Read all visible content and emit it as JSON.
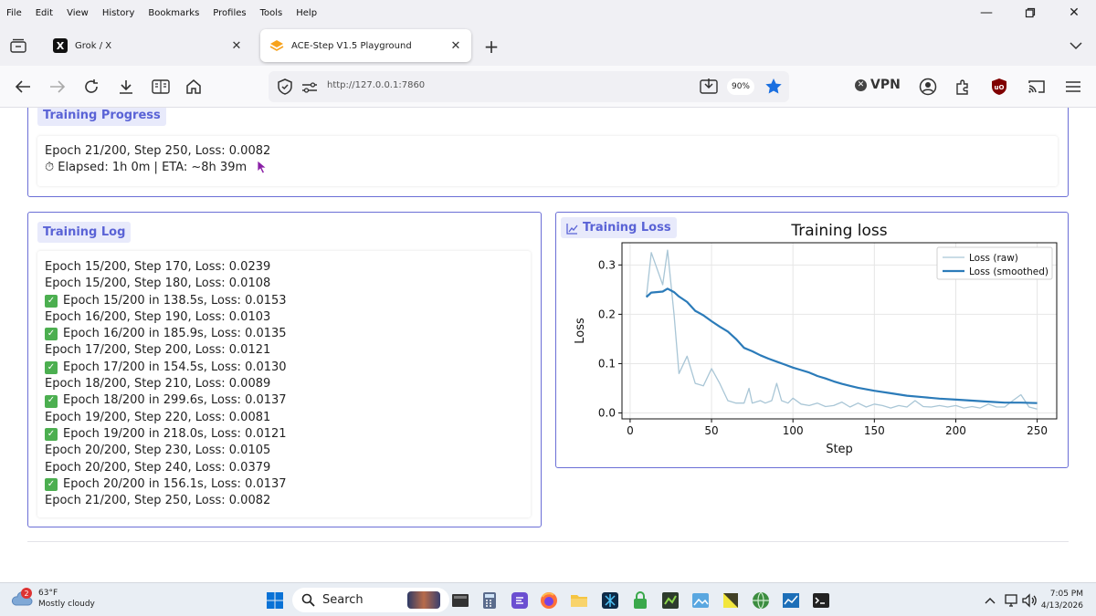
{
  "menu": {
    "items": [
      "File",
      "Edit",
      "View",
      "History",
      "Bookmarks",
      "Profiles",
      "Tools",
      "Help"
    ]
  },
  "tabs": [
    {
      "title": "Grok / X",
      "active": false
    },
    {
      "title": "ACE-Step V1.5 Playground",
      "active": true
    }
  ],
  "navbar": {
    "url": "http://127.0.0.1:7860",
    "zoom": "90%",
    "vpn_label": "VPN"
  },
  "progress_panel": {
    "badge": "Training Progress",
    "line1": "Epoch 21/200, Step 250, Loss: 0.0082",
    "line2": "⏱ Elapsed: 1h 0m | ETA: ~8h 39m"
  },
  "log_panel": {
    "badge": "Training Log",
    "lines": [
      {
        "text": "Epoch 15/200, Step 170, Loss: 0.0239",
        "check": false
      },
      {
        "text": "Epoch 15/200, Step 180, Loss: 0.0108",
        "check": false
      },
      {
        "text": "Epoch 15/200 in 138.5s, Loss: 0.0153",
        "check": true
      },
      {
        "text": "Epoch 16/200, Step 190, Loss: 0.0103",
        "check": false
      },
      {
        "text": "Epoch 16/200 in 185.9s, Loss: 0.0135",
        "check": true
      },
      {
        "text": "Epoch 17/200, Step 200, Loss: 0.0121",
        "check": false
      },
      {
        "text": "Epoch 17/200 in 154.5s, Loss: 0.0130",
        "check": true
      },
      {
        "text": "Epoch 18/200, Step 210, Loss: 0.0089",
        "check": false
      },
      {
        "text": "Epoch 18/200 in 299.6s, Loss: 0.0137",
        "check": true
      },
      {
        "text": "Epoch 19/200, Step 220, Loss: 0.0081",
        "check": false
      },
      {
        "text": "Epoch 19/200 in 218.0s, Loss: 0.0121",
        "check": true
      },
      {
        "text": "Epoch 20/200, Step 230, Loss: 0.0105",
        "check": false
      },
      {
        "text": "Epoch 20/200, Step 240, Loss: 0.0379",
        "check": false
      },
      {
        "text": "Epoch 20/200 in 156.1s, Loss: 0.0137",
        "check": true
      },
      {
        "text": "Epoch 21/200, Step 250, Loss: 0.0082",
        "check": false
      }
    ]
  },
  "loss_panel": {
    "badge": "Training Loss"
  },
  "chart_data": {
    "type": "line",
    "title": "Training loss",
    "xlabel": "Step",
    "ylabel": "Loss",
    "xlim": [
      -5,
      262
    ],
    "ylim": [
      -0.012,
      0.345
    ],
    "xticks": [
      0,
      50,
      100,
      150,
      200,
      250
    ],
    "yticks": [
      0.0,
      0.1,
      0.2,
      0.3
    ],
    "ytick_labels": [
      "0.0",
      "0.1",
      "0.2",
      "0.3"
    ],
    "grid": true,
    "legend_position": "top-right",
    "series": [
      {
        "name": "Loss (raw)",
        "color": "#a9c6d6",
        "x": [
          10,
          13,
          20,
          23,
          27,
          30,
          35,
          40,
          45,
          50,
          55,
          60,
          65,
          70,
          73,
          75,
          80,
          83,
          87,
          90,
          93,
          97,
          100,
          105,
          110,
          115,
          120,
          125,
          130,
          135,
          140,
          145,
          150,
          155,
          160,
          165,
          170,
          175,
          180,
          185,
          190,
          195,
          200,
          205,
          210,
          215,
          220,
          225,
          230,
          235,
          240,
          245,
          250
        ],
        "y": [
          0.235,
          0.325,
          0.26,
          0.33,
          0.2,
          0.08,
          0.115,
          0.06,
          0.055,
          0.09,
          0.06,
          0.025,
          0.02,
          0.02,
          0.05,
          0.02,
          0.025,
          0.02,
          0.025,
          0.06,
          0.025,
          0.02,
          0.03,
          0.018,
          0.015,
          0.02,
          0.013,
          0.015,
          0.022,
          0.012,
          0.02,
          0.012,
          0.018,
          0.015,
          0.01,
          0.015,
          0.012,
          0.025,
          0.013,
          0.012,
          0.015,
          0.012,
          0.015,
          0.01,
          0.013,
          0.01,
          0.018,
          0.012,
          0.012,
          0.025,
          0.037,
          0.012,
          0.008
        ]
      },
      {
        "name": "Loss (smoothed)",
        "color": "#2b7bb9",
        "x": [
          10,
          13,
          20,
          23,
          27,
          30,
          35,
          40,
          45,
          50,
          55,
          60,
          65,
          70,
          75,
          80,
          85,
          90,
          95,
          100,
          105,
          110,
          115,
          120,
          125,
          130,
          135,
          140,
          145,
          150,
          160,
          170,
          180,
          190,
          200,
          210,
          220,
          230,
          240,
          250
        ],
        "y": [
          0.235,
          0.244,
          0.246,
          0.252,
          0.245,
          0.236,
          0.225,
          0.207,
          0.198,
          0.186,
          0.175,
          0.165,
          0.15,
          0.132,
          0.125,
          0.117,
          0.11,
          0.104,
          0.098,
          0.092,
          0.087,
          0.082,
          0.075,
          0.07,
          0.064,
          0.059,
          0.055,
          0.051,
          0.048,
          0.045,
          0.04,
          0.035,
          0.032,
          0.029,
          0.027,
          0.025,
          0.023,
          0.021,
          0.021,
          0.02
        ]
      }
    ]
  },
  "taskbar": {
    "weather_temp": "63°F",
    "weather_desc": "Mostly cloudy",
    "weather_badge": "2",
    "search_label": "Search",
    "time": "7:05 PM",
    "date": "4/13/2026"
  }
}
